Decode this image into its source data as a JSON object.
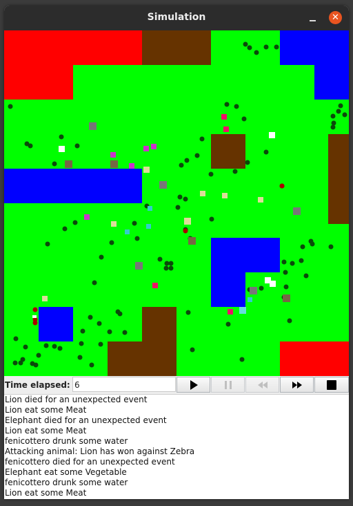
{
  "window": {
    "title": "Simulation",
    "close_glyph": "✕"
  },
  "map": {
    "colors": {
      "grass": "#00ff00",
      "water": "#0000ff",
      "lava": "#ff0000",
      "soil": "#663300",
      "tree": "#0b4a0b"
    }
  },
  "controls": {
    "time_label": "Time elapsed:",
    "time_value": "6",
    "buttons": [
      {
        "name": "play-button",
        "icon": "play-icon",
        "enabled": true
      },
      {
        "name": "pause-button",
        "icon": "pause-icon",
        "enabled": false
      },
      {
        "name": "rewind-button",
        "icon": "rewind-icon",
        "enabled": false
      },
      {
        "name": "fast-forward-button",
        "icon": "fast-forward-icon",
        "enabled": true
      },
      {
        "name": "stop-button",
        "icon": "stop-icon",
        "enabled": true
      }
    ]
  },
  "log": [
    "Lion died for an unexpected event",
    "Lion eat some Meat",
    "Elephant died for an unexpected event",
    "Lion eat some Meat",
    "fenicottero drunk some water",
    "Attacking animal: Lion has won against Zebra",
    "fenicottero died for an unexpected event",
    "Elephant eat some Vegetable",
    "fenicottero drunk some water",
    "Lion eat some Meat"
  ]
}
